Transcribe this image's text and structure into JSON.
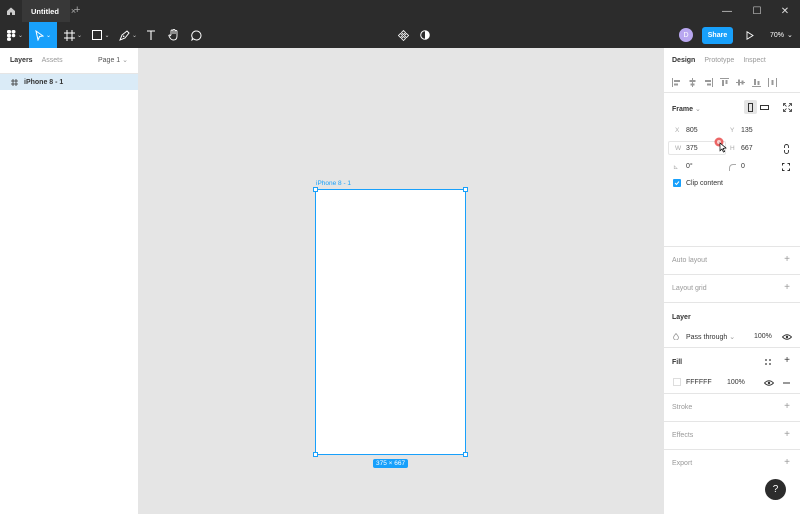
{
  "tabbar": {
    "file_title": "Untitled",
    "close_glyph": "×",
    "new_tab_glyph": "+",
    "window_controls": {
      "minimize": "—",
      "maximize": "☐",
      "close": "✕"
    }
  },
  "toolbar": {
    "avatar_initial": "D",
    "share_label": "Share",
    "zoom_label": "70%"
  },
  "left_panel": {
    "tabs": {
      "layers": "Layers",
      "assets": "Assets"
    },
    "page_label": "Page 1",
    "layers": [
      {
        "name": "iPhone 8 - 1"
      }
    ]
  },
  "canvas": {
    "frame_label": "iPhone 8 - 1",
    "size_badge": "375 × 667"
  },
  "right_panel": {
    "tabs": {
      "design": "Design",
      "prototype": "Prototype",
      "inspect": "Inspect"
    },
    "frame": {
      "title": "Frame",
      "x_label": "X",
      "x_value": "805",
      "y_label": "Y",
      "y_value": "135",
      "w_label": "W",
      "w_value": "375",
      "h_label": "H",
      "h_value": "667",
      "rotation_value": "0°",
      "radius_value": "0",
      "clip_content_label": "Clip content",
      "clip_content_checked": true
    },
    "auto_layout": {
      "title": "Auto layout"
    },
    "layout_grid": {
      "title": "Layout grid"
    },
    "layer": {
      "title": "Layer",
      "blend_mode": "Pass through",
      "opacity": "100%"
    },
    "fill": {
      "title": "Fill",
      "color_hex": "FFFFFF",
      "opacity": "100%",
      "swatch_color": "#ffffff"
    },
    "stroke": {
      "title": "Stroke"
    },
    "effects": {
      "title": "Effects"
    },
    "export": {
      "title": "Export"
    }
  },
  "help_label": "?",
  "colors": {
    "accent": "#18a0fb",
    "toolbar_bg": "#2c2c2c",
    "canvas_bg": "#e5e5e5"
  }
}
